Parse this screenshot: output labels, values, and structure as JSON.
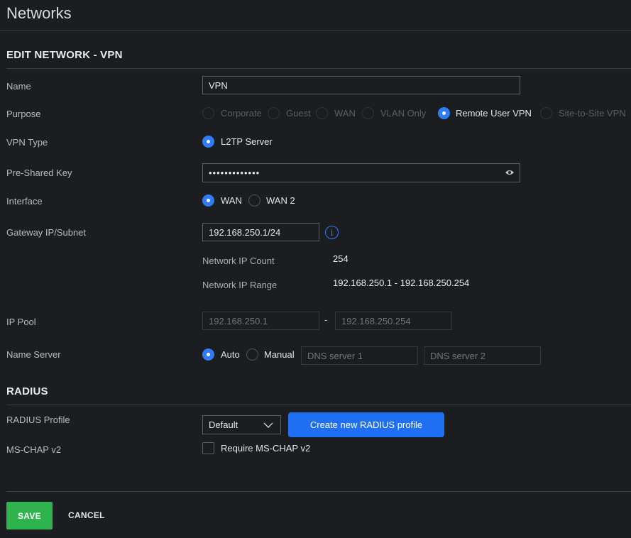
{
  "page": {
    "title": "Networks"
  },
  "edit_section": {
    "title": "EDIT NETWORK - VPN"
  },
  "name": {
    "label": "Name",
    "value": "VPN"
  },
  "purpose": {
    "label": "Purpose",
    "options": [
      {
        "label": "Corporate",
        "selected": false
      },
      {
        "label": "Guest",
        "selected": false
      },
      {
        "label": "WAN",
        "selected": false
      },
      {
        "label": "VLAN Only",
        "selected": false
      },
      {
        "label": "Remote User VPN",
        "selected": true
      },
      {
        "label": "Site-to-Site VPN",
        "selected": false
      }
    ]
  },
  "vpn_type": {
    "label": "VPN Type",
    "option": "L2TP Server"
  },
  "psk": {
    "label": "Pre-Shared Key",
    "value": "•••••••••••••"
  },
  "interface": {
    "label": "Interface",
    "options": [
      {
        "label": "WAN",
        "selected": true
      },
      {
        "label": "WAN 2",
        "selected": false
      }
    ]
  },
  "gateway": {
    "label": "Gateway IP/Subnet",
    "value": "192.168.250.1/24",
    "ip_count_label": "Network IP Count",
    "ip_count": "254",
    "ip_range_label": "Network IP Range",
    "ip_range": "192.168.250.1 - 192.168.250.254"
  },
  "ip_pool": {
    "label": "IP Pool",
    "start_placeholder": "192.168.250.1",
    "separator": "-",
    "end_placeholder": "192.168.250.254"
  },
  "name_server": {
    "label": "Name Server",
    "auto_label": "Auto",
    "manual_label": "Manual",
    "dns1_placeholder": "DNS server 1",
    "dns2_placeholder": "DNS server 2"
  },
  "radius_section": {
    "title": "RADIUS"
  },
  "radius_profile": {
    "label": "RADIUS Profile",
    "selected": "Default",
    "create_button": "Create new RADIUS profile"
  },
  "mschap": {
    "label": "MS-CHAP v2",
    "checkbox_label": "Require MS-CHAP v2",
    "checked": false
  },
  "footer": {
    "save": "SAVE",
    "cancel": "CANCEL"
  },
  "colors": {
    "accent": "#2f7cf6",
    "save_green": "#2eb34d",
    "background": "#1b1d21"
  }
}
